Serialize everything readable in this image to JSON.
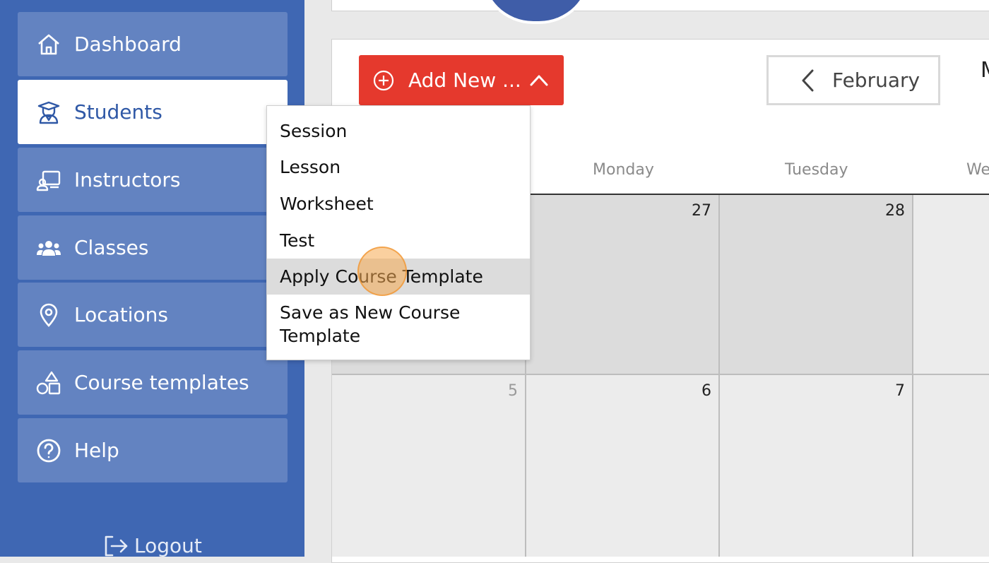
{
  "sidebar": {
    "items": [
      {
        "label": "Dashboard",
        "icon": "home-icon"
      },
      {
        "label": "Students",
        "icon": "graduate-icon"
      },
      {
        "label": "Instructors",
        "icon": "instructor-icon"
      },
      {
        "label": "Classes",
        "icon": "group-icon"
      },
      {
        "label": "Locations",
        "icon": "map-pin-icon"
      },
      {
        "label": "Course templates",
        "icon": "shapes-icon"
      },
      {
        "label": "Help",
        "icon": "help-icon"
      }
    ],
    "active": "Students",
    "logout_label": "Logout"
  },
  "toolbar": {
    "add_new_label": "Add New ...",
    "month_label": "February",
    "clipped_text": "M"
  },
  "add_menu": {
    "items": [
      "Session",
      "Lesson",
      "Worksheet",
      "Test",
      "Apply Course Template",
      "Save as New Course Template"
    ],
    "highlighted": "Apply Course Template"
  },
  "calendar": {
    "day_headers": [
      "Monday",
      "Tuesday",
      "We"
    ],
    "rows": [
      [
        "",
        "27",
        "28",
        ""
      ],
      [
        "5",
        "6",
        "7",
        ""
      ]
    ]
  },
  "colors": {
    "sidebar_bg": "#3f67b3",
    "nav_item_bg": "#6383c1",
    "accent_red": "#e5392d",
    "active_text": "#2f58a6"
  }
}
